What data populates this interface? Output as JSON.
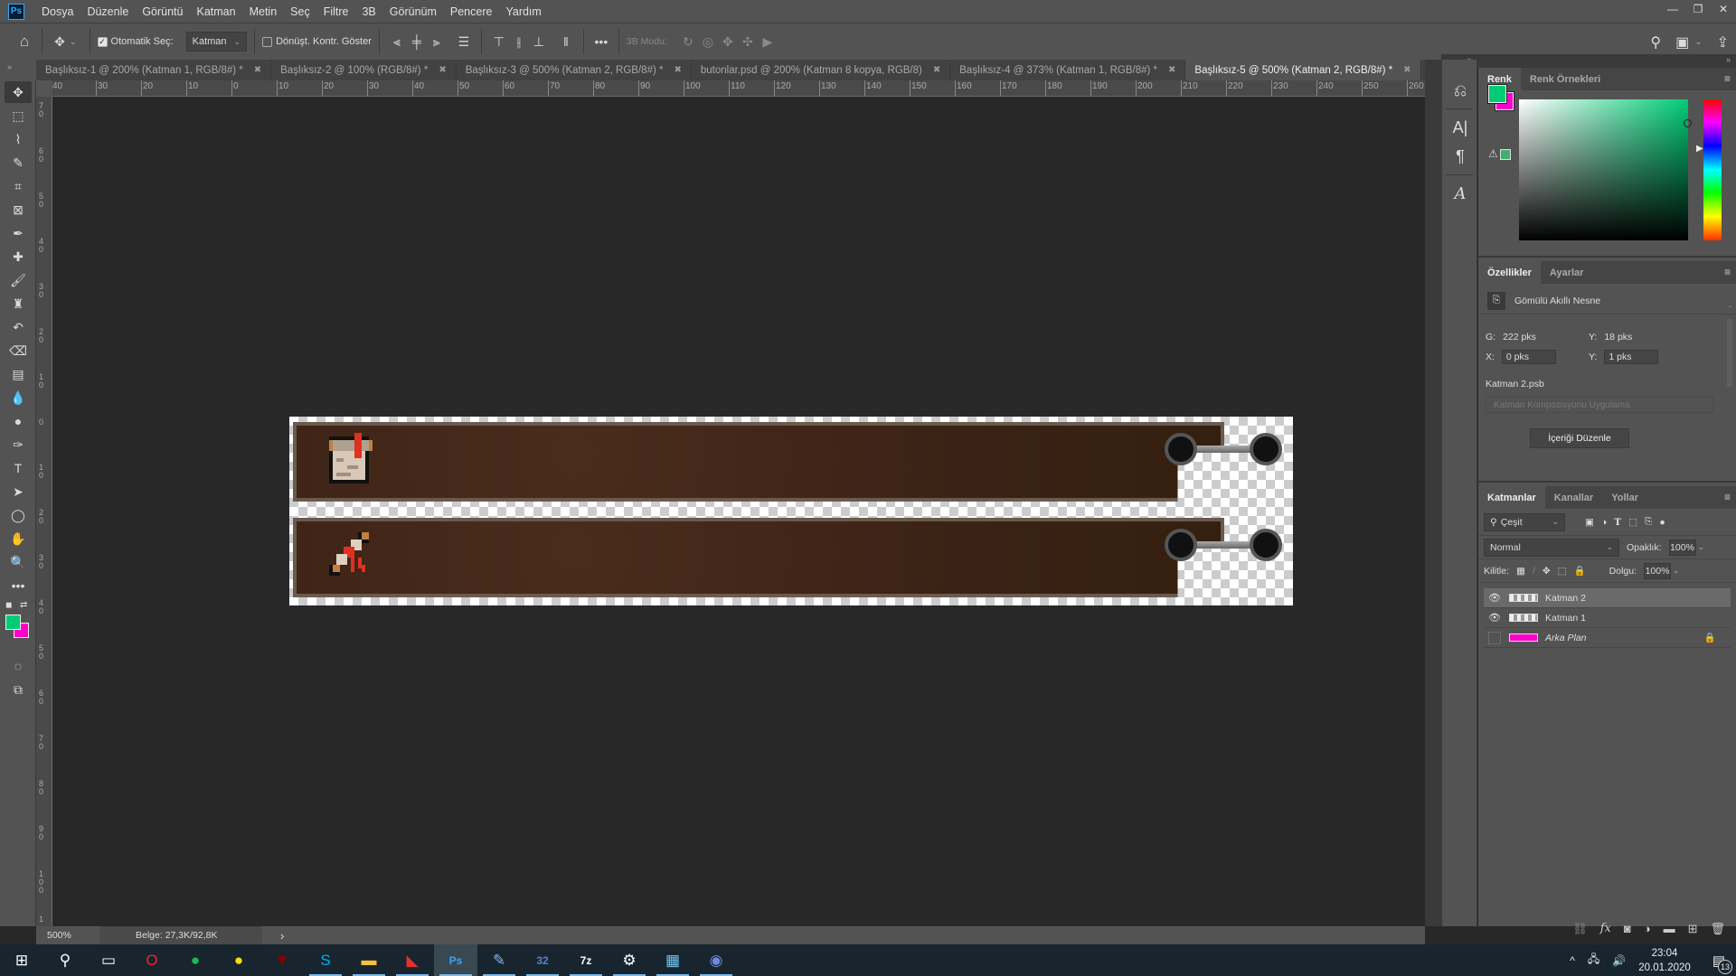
{
  "app": {
    "name": "Photoshop",
    "logo": "Ps"
  },
  "menubar": {
    "items": [
      "Dosya",
      "Düzenle",
      "Görüntü",
      "Katman",
      "Metin",
      "Seç",
      "Filtre",
      "3B",
      "Görünüm",
      "Pencere",
      "Yardım"
    ]
  },
  "window_controls": {
    "minimize": "—",
    "restore": "❐",
    "close": "✕"
  },
  "options_bar": {
    "auto_select_label": "Otomatik Seç:",
    "auto_select_checked": true,
    "auto_select_target": "Katman",
    "show_transform_label": "Dönüşt. Kontr. Göster",
    "show_transform_checked": false,
    "more_label": "•••",
    "mode_3d_label": "3B Modu:"
  },
  "tabs": [
    {
      "label": "Başlıksız-1 @ 200% (Katman 1, RGB/8#) *",
      "active": false
    },
    {
      "label": "Başlıksız-2 @ 100% (RGB/8#) *",
      "active": false
    },
    {
      "label": "Başlıksız-3 @ 500% (Katman 2, RGB/8#) *",
      "active": false
    },
    {
      "label": "butonlar.psd @ 200% (Katman 8 kopya, RGB/8)",
      "active": false
    },
    {
      "label": "Başlıksız-4 @ 373% (Katman 1, RGB/8#) *",
      "active": false
    },
    {
      "label": "Başlıksız-5 @ 500% (Katman 2, RGB/8#) *",
      "active": true
    }
  ],
  "rulers": {
    "horizontal": [
      "40",
      "30",
      "20",
      "10",
      "0",
      "10",
      "20",
      "30",
      "40",
      "50",
      "60",
      "70",
      "80",
      "90",
      "100",
      "110",
      "120",
      "130",
      "140",
      "150",
      "160",
      "170",
      "180",
      "190",
      "200",
      "210",
      "220",
      "230",
      "240",
      "250",
      "260"
    ],
    "vertical": [
      "70",
      "60",
      "50",
      "40",
      "30",
      "20",
      "10",
      "0",
      "10",
      "20",
      "30",
      "40",
      "50",
      "60",
      "70",
      "80",
      "90",
      "100",
      "1"
    ]
  },
  "tools": [
    {
      "name": "move-tool",
      "glyph": "✥"
    },
    {
      "name": "marquee-tool",
      "glyph": "⬚"
    },
    {
      "name": "lasso-tool",
      "glyph": "⌇"
    },
    {
      "name": "quick-select-tool",
      "glyph": "✎"
    },
    {
      "name": "crop-tool",
      "glyph": "⌗"
    },
    {
      "name": "frame-tool",
      "glyph": "⊠"
    },
    {
      "name": "eyedropper-tool",
      "glyph": "✒"
    },
    {
      "name": "healing-brush-tool",
      "glyph": "✚"
    },
    {
      "name": "brush-tool",
      "glyph": "🖌"
    },
    {
      "name": "clone-stamp-tool",
      "glyph": "♜"
    },
    {
      "name": "history-brush-tool",
      "glyph": "↶"
    },
    {
      "name": "eraser-tool",
      "glyph": "⌫"
    },
    {
      "name": "gradient-tool",
      "glyph": "▤"
    },
    {
      "name": "blur-tool",
      "glyph": "💧"
    },
    {
      "name": "dodge-tool",
      "glyph": "●"
    },
    {
      "name": "pen-tool",
      "glyph": "✑"
    },
    {
      "name": "type-tool",
      "glyph": "T"
    },
    {
      "name": "path-select-tool",
      "glyph": "➤"
    },
    {
      "name": "ellipse-tool",
      "glyph": "◯"
    },
    {
      "name": "hand-tool",
      "glyph": "✋"
    },
    {
      "name": "zoom-tool",
      "glyph": "🔍"
    },
    {
      "name": "more-tools",
      "glyph": "•••"
    }
  ],
  "colors": {
    "foreground": "#00cc77",
    "background": "#ff00cc",
    "gamut_swatch": "#40b070",
    "accent": "#31a8ff"
  },
  "canvas": {
    "buttons": [
      {
        "icon": "scroll-icon"
      },
      {
        "icon": "quill-icon"
      }
    ]
  },
  "statusbar": {
    "zoom": "500%",
    "doc_info": "Belge: 27,3K/92,8K",
    "arrow": "›"
  },
  "color_panel": {
    "tabs": [
      "Renk",
      "Renk Örnekleri"
    ],
    "active_tab": "Renk"
  },
  "properties_panel": {
    "tabs": [
      "Özellikler",
      "Ayarlar"
    ],
    "active_tab": "Özellikler",
    "object_type": "Gömülü Akıllı Nesne",
    "width_label": "G:",
    "width_value": "222 pks",
    "height_label": "Y:",
    "height_value": "18 pks",
    "x_label": "X:",
    "x_value": "0 pks",
    "y_label": "Y:",
    "y_value": "1 pks",
    "file_name": "Katman 2.psb",
    "comp_placeholder": "Katman Kompozisyonu Uygulama",
    "edit_button": "İçeriği Düzenle"
  },
  "layers_panel": {
    "tabs": [
      "Katmanlar",
      "Kanallar",
      "Yollar"
    ],
    "active_tab": "Katmanlar",
    "filter_kind": "Çeşit",
    "blend_mode": "Normal",
    "opacity_label": "Opaklık:",
    "opacity": "100%",
    "lock_label": "Kilitle:",
    "fill_label": "Dolgu:",
    "fill": "100%",
    "layers": [
      {
        "name": "Katman 2",
        "visible": true,
        "selected": true,
        "locked": false,
        "italic": false
      },
      {
        "name": "Katman 1",
        "visible": true,
        "selected": false,
        "locked": false,
        "italic": false
      },
      {
        "name": "Arka Plan",
        "visible": false,
        "selected": false,
        "locked": true,
        "italic": true
      }
    ]
  },
  "taskbar": {
    "apps": [
      {
        "name": "start",
        "glyph": "⊞",
        "color": "#ffffff",
        "running": false
      },
      {
        "name": "search",
        "glyph": "⚲",
        "color": "#ffffff",
        "running": false
      },
      {
        "name": "task-view",
        "glyph": "▭",
        "color": "#ffffff",
        "running": false
      },
      {
        "name": "opera",
        "glyph": "O",
        "color": "#ff1b2d",
        "running": false
      },
      {
        "name": "spotify",
        "glyph": "●",
        "color": "#1db954",
        "running": false
      },
      {
        "name": "magnifier",
        "glyph": "●",
        "color": "#f5e000",
        "running": false
      },
      {
        "name": "gaming-app",
        "glyph": "▼",
        "color": "#8b0000",
        "running": false
      },
      {
        "name": "skype",
        "glyph": "S",
        "color": "#00aff0",
        "running": true
      },
      {
        "name": "file-explorer",
        "glyph": "▬",
        "color": "#f8c03c",
        "running": true
      },
      {
        "name": "cinema4d",
        "glyph": "◣",
        "color": "#e53030",
        "running": true
      },
      {
        "name": "photoshop",
        "glyph": "Ps",
        "color": "#31a8ff",
        "running": true,
        "active": true
      },
      {
        "name": "paint-app",
        "glyph": "✎",
        "color": "#8ab4f8",
        "running": true
      },
      {
        "name": "epack",
        "glyph": "32",
        "color": "#5a7fd6",
        "running": true
      },
      {
        "name": "7zip",
        "glyph": "7z",
        "color": "#ffffff",
        "running": true
      },
      {
        "name": "settings",
        "glyph": "⚙",
        "color": "#ffffff",
        "running": true
      },
      {
        "name": "control-panel",
        "glyph": "▦",
        "color": "#6ec6f5",
        "running": true
      },
      {
        "name": "discord",
        "glyph": "◉",
        "color": "#7289da",
        "running": true
      }
    ],
    "tray": {
      "chevron": "^",
      "network": "🖧",
      "volume": "🔊",
      "time": "23:04",
      "date": "20.01.2020",
      "notifications": "13"
    }
  }
}
